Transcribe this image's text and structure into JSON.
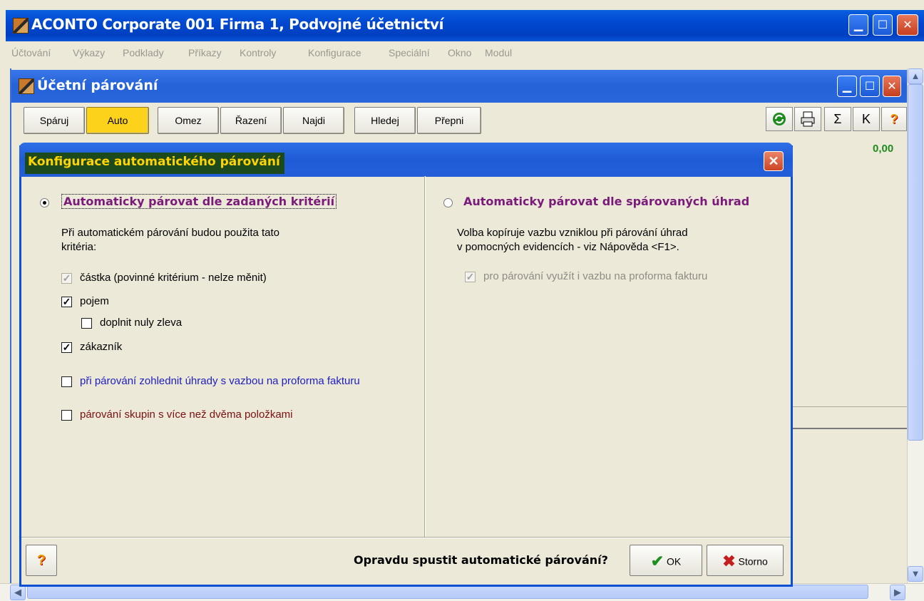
{
  "app": {
    "title": "ACONTO Corporate 001 Firma 1, Podvojné účetnictví",
    "menu": [
      "Účtování",
      "Výkazy",
      "Podklady",
      "Příkazy",
      "Kontroly",
      "Konfigurace",
      "Speciální",
      "Okno",
      "Modul"
    ]
  },
  "child": {
    "title": "Účetní párování",
    "toolbar": [
      "Spáruj",
      "Auto",
      "Omez",
      "Řazení",
      "Najdi",
      "Hledej",
      "Přepni"
    ],
    "active_button": "Auto",
    "icons": [
      "refresh-icon",
      "print-icon",
      "sum-icon",
      "k-icon",
      "help-icon"
    ],
    "sum_text": "Σ",
    "k_text": "K",
    "help_text": "?",
    "value": "0,00"
  },
  "dialog": {
    "title": "Konfigurace automatického párování",
    "left": {
      "radio_label": "Automaticky párovat dle zadaných kritérií",
      "radio_selected": true,
      "desc_line1": "Při automatickém párování budou použita tato",
      "desc_line2": "kritéria:",
      "checks": [
        {
          "label": "částka (povinné kritérium - nelze měnit)",
          "checked": true,
          "disabled": true
        },
        {
          "label": "pojem",
          "checked": true,
          "disabled": false
        },
        {
          "label": "doplnit nuly zleva",
          "checked": false,
          "disabled": false
        },
        {
          "label": "zákazník",
          "checked": true,
          "disabled": false
        },
        {
          "label": "při párování zohlednit úhrady s vazbou na proforma fakturu",
          "checked": false,
          "disabled": false
        },
        {
          "label": "párování skupin s více než dvěma položkami",
          "checked": false,
          "disabled": false
        }
      ]
    },
    "right": {
      "radio_label": "Automaticky párovat dle spárovaných úhrad",
      "radio_selected": false,
      "desc_line1": "Volba kopíruje vazbu vzniklou při párování úhrad",
      "desc_line2": "v pomocných evidencích - viz Nápověda <F1>.",
      "check_label": "pro párování využít i vazbu na proforma fakturu",
      "check_checked": true,
      "check_disabled": true
    },
    "question": "Opravdu spustit automatické párování?",
    "ok_label": "OK",
    "cancel_label": "Storno",
    "help_text": "?"
  },
  "colors": {
    "highlight_button": "#fcd31a",
    "dialog_title_bg": "#1c4a1c",
    "dialog_title_fg": "#ffd400",
    "radio_label": "#7a1a7a",
    "blue_label": "#2020c0",
    "maroon_label": "#7a1010"
  }
}
